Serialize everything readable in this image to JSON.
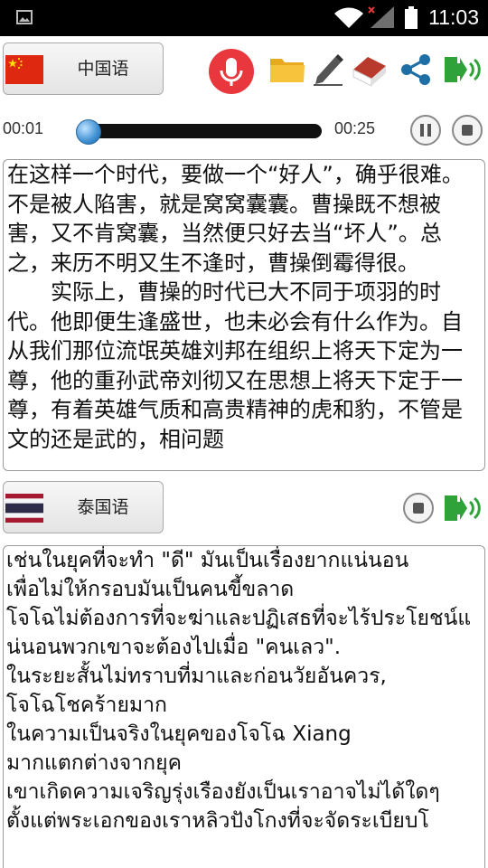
{
  "status_bar": {
    "time": "11:03",
    "icons": [
      "gallery-icon",
      "wifi-icon",
      "signal-icon",
      "battery-icon"
    ]
  },
  "source": {
    "language_label": "中国语",
    "flag": "china-flag",
    "toolbar_icons": [
      "microphone-icon",
      "folder-icon",
      "pencil-icon",
      "eraser-icon",
      "share-icon",
      "speaker-exit-icon"
    ],
    "accent_color": "#e8383d"
  },
  "player": {
    "elapsed": "00:01",
    "total": "00:25",
    "progress": 0.04,
    "pause_icon": "pause-icon",
    "stop_icon": "stop-icon"
  },
  "source_text": "在这样一个时代，要做一个“好人”，确乎很难。不是被人陷害，就是窝窝囊囊。曹操既不想被害，又不肯窝囊，当然便只好去当“坏人”。总之，来历不明又生不逢时，曹操倒霉得很。\n　　实际上，曹操的时代已大不同于项羽的时代。他即便生逢盛世，也未必会有什么作为。自从我们那位流氓英雄刘邦在组织上将天下定为一尊，他的重孙武帝刘彻又在思想上将天下定于一尊，有着英雄气质和高贵精神的虎和豹，不管是文的还是武的，相问题",
  "target": {
    "language_label": "泰国语",
    "flag": "thailand-flag",
    "toolbar_icons": [
      "stop-icon",
      "speaker-exit-icon"
    ]
  },
  "target_text": "เช่นในยุคที่จะทำ \"ดี\" มันเป็นเรื่องยากแน่นอน\nเพื่อไม่ให้กรอบมันเป็นคนขี้ขลาด\nโจโฉไม่ต้องการที่จะฆ่าและปฏิเสธที่จะไร้ประโยชน์แน่นอนพวกเขาจะต้องไปเมื่อ \"คนเลว\".\nในระยะสั้นไม่ทราบที่มาและก่อนวัยอันควร,\nโจโฉโชคร้ายมาก\nในความเป็นจริงในยุคของโจโฉ Xiang\nมากแตกต่างจากยุค\nเขาเกิดความเจริญรุ่งเรืองยังเป็นเราอาจไม่ได้ใดๆ\nตั้งแต่พระเอกของเราหลิวปังโกงที่จะจัดระเบียบโ"
}
